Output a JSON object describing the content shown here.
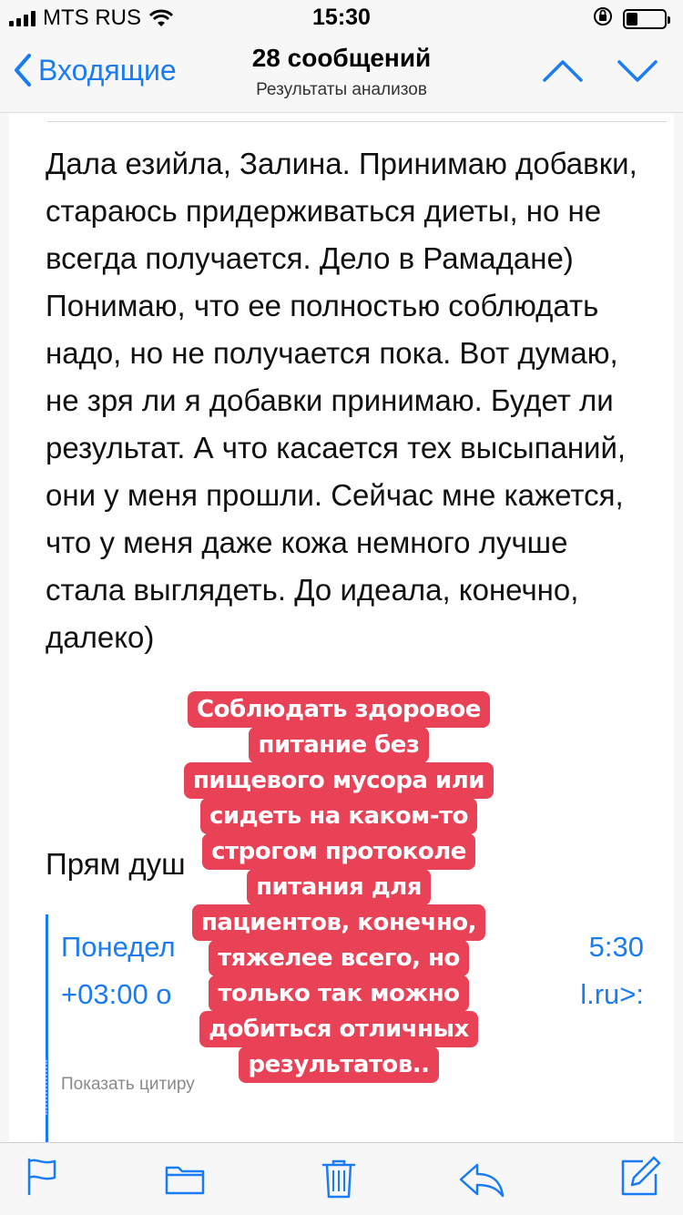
{
  "status_bar": {
    "carrier": "MTS RUS",
    "time": "15:30",
    "battery_level": 0.3,
    "icons": [
      "signal-icon",
      "wifi-icon",
      "orientation-lock-icon",
      "battery-icon"
    ]
  },
  "nav": {
    "back_label": "Входящие",
    "title": "28 сообщений",
    "subtitle": "Результаты анализов"
  },
  "message": {
    "body": "Дала езийла, Залина. Принимаю добавки, стараюсь придерживаться диеты, но не всегда получается. Дело в Рамадане) Понимаю, что ее полностью соблюдать надо, но не получается пока. Вот думаю, не зря ли я добавки принимаю. Будет ли результат. А что касается тех высыпаний, они у меня прошли. Сейчас мне кажется, что у меня даже кожа немного лучше стала выглядеть. До идеала, конечно, далеко)",
    "line2": "Прям душ",
    "quote_line1": "Понедел",
    "quote_line1_end": "5:30",
    "quote_line2": "+03:00 о",
    "quote_line2_end": "l.ru>:",
    "show_quote": "Показать цитиру"
  },
  "overlay": {
    "lines": [
      "Соблюдать здоровое",
      "питание без",
      "пищевого мусора или",
      "сидеть на каком-то",
      "строгом протоколе",
      "питания для",
      "пациентов, конечно,",
      "тяжелее всего, но",
      "только так можно",
      "добиться отличных",
      "результатов.."
    ],
    "color": "#e94257"
  },
  "toolbar": {
    "icons": [
      "flag-icon",
      "folder-icon",
      "trash-icon",
      "reply-icon",
      "compose-icon"
    ]
  },
  "colors": {
    "accent": "#1a7cf5",
    "overlay": "#e94257"
  }
}
